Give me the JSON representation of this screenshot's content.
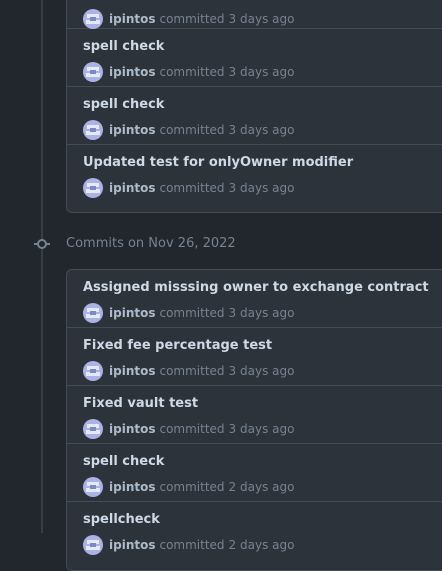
{
  "colors": {
    "background": "#22272e",
    "card": "#2d333b",
    "border": "#444c56",
    "title": "#cdd9e5",
    "muted": "#768390",
    "avatar": "#aab2e6"
  },
  "group_a": {
    "commits": [
      {
        "title": "",
        "author": "ipintos",
        "verb": "committed",
        "time": "3 days ago"
      },
      {
        "title": "spell check",
        "author": "ipintos",
        "verb": "committed",
        "time": "3 days ago"
      },
      {
        "title": "spell check",
        "author": "ipintos",
        "verb": "committed",
        "time": "3 days ago"
      },
      {
        "title": "Updated test for onlyOwner modifier",
        "author": "ipintos",
        "verb": "committed",
        "time": "3 days ago"
      }
    ]
  },
  "date_header": {
    "label": "Commits on Nov 26, 2022",
    "icon": "git-commit-icon"
  },
  "group_b": {
    "commits": [
      {
        "title": "Assigned misssing owner to exchange contract",
        "author": "ipintos",
        "verb": "committed",
        "time": "3 days ago"
      },
      {
        "title": "Fixed fee percentage test",
        "author": "ipintos",
        "verb": "committed",
        "time": "3 days ago"
      },
      {
        "title": "Fixed vault test",
        "author": "ipintos",
        "verb": "committed",
        "time": "3 days ago"
      },
      {
        "title": "spell check",
        "author": "ipintos",
        "verb": "committed",
        "time": "2 days ago"
      },
      {
        "title": "spellcheck",
        "author": "ipintos",
        "verb": "committed",
        "time": "2 days ago"
      }
    ]
  }
}
